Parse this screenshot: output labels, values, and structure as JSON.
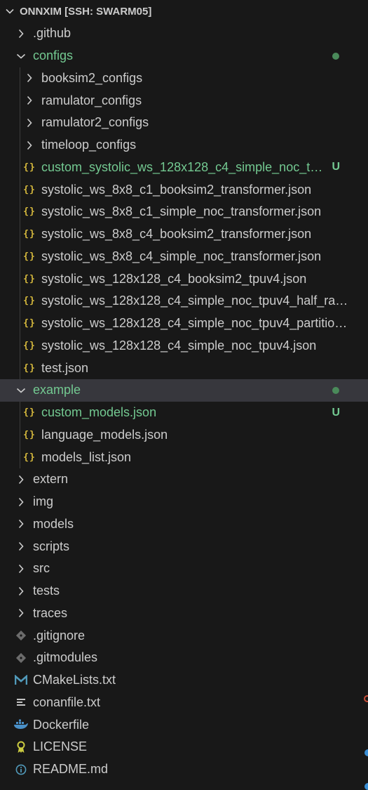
{
  "explorer": {
    "title": "ONNXIM [SSH: SWARM05]",
    "colors": {
      "background": "#181818",
      "selected_row": "#37373d",
      "text": "#cccccc",
      "git_untracked": "#73c991",
      "json_icon": "#d7ba3d",
      "modified_dot": "#4a8a5a"
    },
    "items": [
      {
        "label": ".github",
        "type": "folder",
        "expanded": false
      },
      {
        "label": "configs",
        "type": "folder",
        "expanded": true,
        "status": "dot"
      },
      {
        "label": "booksim2_configs",
        "type": "folder",
        "expanded": false
      },
      {
        "label": "ramulator_configs",
        "type": "folder",
        "expanded": false
      },
      {
        "label": "ramulator2_configs",
        "type": "folder",
        "expanded": false
      },
      {
        "label": "timeloop_configs",
        "type": "folder",
        "expanded": false
      },
      {
        "label": "custom_systolic_ws_128x128_c4_simple_noc_tp...",
        "type": "json",
        "status": "U"
      },
      {
        "label": "systolic_ws_8x8_c1_booksim2_transformer.json",
        "type": "json"
      },
      {
        "label": "systolic_ws_8x8_c1_simple_noc_transformer.json",
        "type": "json"
      },
      {
        "label": "systolic_ws_8x8_c4_booksim2_transformer.json",
        "type": "json"
      },
      {
        "label": "systolic_ws_8x8_c4_simple_noc_transformer.json",
        "type": "json"
      },
      {
        "label": "systolic_ws_128x128_c4_booksim2_tpuv4.json",
        "type": "json"
      },
      {
        "label": "systolic_ws_128x128_c4_simple_noc_tpuv4_half_ram...",
        "type": "json"
      },
      {
        "label": "systolic_ws_128x128_c4_simple_noc_tpuv4_partition_...",
        "type": "json"
      },
      {
        "label": "systolic_ws_128x128_c4_simple_noc_tpuv4.json",
        "type": "json"
      },
      {
        "label": "test.json",
        "type": "json"
      },
      {
        "label": "example",
        "type": "folder",
        "expanded": true,
        "status": "dot"
      },
      {
        "label": "custom_models.json",
        "type": "json",
        "status": "U"
      },
      {
        "label": "language_models.json",
        "type": "json"
      },
      {
        "label": "models_list.json",
        "type": "json"
      },
      {
        "label": "extern",
        "type": "folder",
        "expanded": false
      },
      {
        "label": "img",
        "type": "folder",
        "expanded": false
      },
      {
        "label": "models",
        "type": "folder",
        "expanded": false
      },
      {
        "label": "scripts",
        "type": "folder",
        "expanded": false
      },
      {
        "label": "src",
        "type": "folder",
        "expanded": false
      },
      {
        "label": "tests",
        "type": "folder",
        "expanded": false
      },
      {
        "label": "traces",
        "type": "folder",
        "expanded": false
      },
      {
        "label": ".gitignore",
        "type": "git"
      },
      {
        "label": ".gitmodules",
        "type": "git"
      },
      {
        "label": "CMakeLists.txt",
        "type": "cmake"
      },
      {
        "label": "conanfile.txt",
        "type": "text"
      },
      {
        "label": "Dockerfile",
        "type": "docker"
      },
      {
        "label": "LICENSE",
        "type": "license"
      },
      {
        "label": "README.md",
        "type": "info"
      }
    ]
  }
}
